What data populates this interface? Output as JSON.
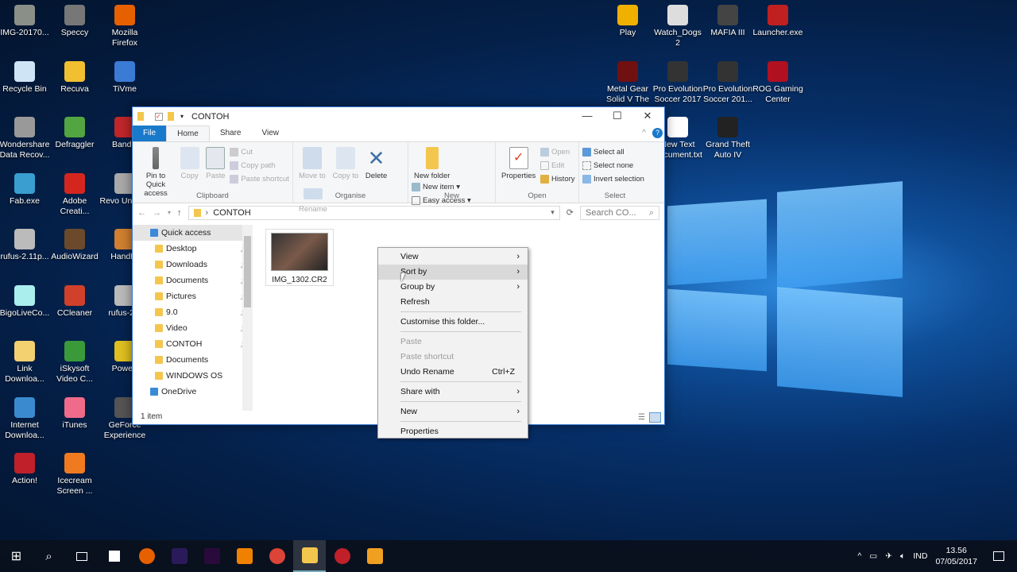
{
  "desktop": {
    "left_icons": [
      {
        "label": "IMG-20170...",
        "color": "#8a8f88"
      },
      {
        "label": "Speccy",
        "color": "#777"
      },
      {
        "label": "Mozilla Firefox",
        "color": "#e66000"
      },
      {
        "label": "Recycle Bin",
        "color": "#cfe4f5"
      },
      {
        "label": "Recuva",
        "color": "#f0c030"
      },
      {
        "label": "TiVme",
        "color": "#3a7bd5"
      },
      {
        "label": "Wondershare Data Recov...",
        "color": "#999"
      },
      {
        "label": "Defraggler",
        "color": "#52a540"
      },
      {
        "label": "Bandic",
        "color": "#c0262a"
      },
      {
        "label": "Fab.exe",
        "color": "#3a9ed0"
      },
      {
        "label": "Adobe Creati...",
        "color": "#d4261f"
      },
      {
        "label": "Revo Uninsta",
        "color": "#aaa"
      },
      {
        "label": "rufus-2.11p...",
        "color": "#bbb"
      },
      {
        "label": "AudioWizard",
        "color": "#6a4a2a"
      },
      {
        "label": "HandBr",
        "color": "#d08030"
      },
      {
        "label": "BigoLiveCo...",
        "color": "#aee"
      },
      {
        "label": "CCleaner",
        "color": "#d0402a"
      },
      {
        "label": "rufus-2.6",
        "color": "#bbb"
      },
      {
        "label": "Link Downloa...",
        "color": "#f3d070"
      },
      {
        "label": "iSkysoft Video C...",
        "color": "#3a9a3a"
      },
      {
        "label": "PowerI",
        "color": "#e0c020"
      },
      {
        "label": "Internet Downloa...",
        "color": "#3a8ad0"
      },
      {
        "label": "iTunes",
        "color": "#f06a8a"
      },
      {
        "label": "GeForce Experience",
        "color": "#555"
      },
      {
        "label": "Action!",
        "color": "#c0202a"
      },
      {
        "label": "Icecream Screen ...",
        "color": "#f07a20"
      }
    ],
    "right_icons": [
      {
        "label": "Play",
        "color": "#f0b000"
      },
      {
        "label": "Watch_Dogs 2",
        "color": "#ddd"
      },
      {
        "label": "MAFIA III",
        "color": "#444"
      },
      {
        "label": "Launcher.exe",
        "color": "#c02020"
      },
      {
        "label": "Metal Gear Solid V The ...",
        "color": "#701010"
      },
      {
        "label": "Pro Evolution Soccer 2017",
        "color": "#333"
      },
      {
        "label": "Pro Evolution Soccer 201...",
        "color": "#333"
      },
      {
        "label": "ROG Gaming Center",
        "color": "#b01020"
      },
      {
        "label": "New Text Document.txt",
        "color": "#fff"
      },
      {
        "label": "Grand Theft Auto IV",
        "color": "#222"
      }
    ]
  },
  "explorer": {
    "title": "CONTOH",
    "tabs": [
      "File",
      "Home",
      "Share",
      "View"
    ],
    "ribbon": {
      "clipboard": {
        "pin": "Pin to Quick access",
        "copy": "Copy",
        "paste": "Paste",
        "cut": "Cut",
        "copy_path": "Copy path",
        "paste_shortcut": "Paste shortcut",
        "label": "Clipboard"
      },
      "organise": {
        "move": "Move to",
        "copy": "Copy to",
        "delete": "Delete",
        "rename": "Rename",
        "label": "Organise"
      },
      "new": {
        "folder": "New folder",
        "item": "New item",
        "easy": "Easy access",
        "label": "New"
      },
      "open": {
        "properties": "Properties",
        "open": "Open",
        "edit": "Edit",
        "history": "History",
        "label": "Open"
      },
      "select": {
        "all": "Select all",
        "none": "Select none",
        "invert": "Invert selection",
        "label": "Select"
      }
    },
    "address": "CONTOH",
    "search_placeholder": "Search CO...",
    "nav": [
      {
        "label": "Quick access",
        "pin": false
      },
      {
        "label": "Desktop",
        "pin": true
      },
      {
        "label": "Downloads",
        "pin": true
      },
      {
        "label": "Documents",
        "pin": true
      },
      {
        "label": "Pictures",
        "pin": true
      },
      {
        "label": "9.0",
        "pin": true
      },
      {
        "label": "Video",
        "pin": true
      },
      {
        "label": "CONTOH",
        "pin": true
      },
      {
        "label": "Documents",
        "pin": false
      },
      {
        "label": "WINDOWS OS",
        "pin": false
      },
      {
        "label": "OneDrive",
        "pin": false
      }
    ],
    "file": {
      "name": "IMG_1302.CR2"
    },
    "status": "1 item"
  },
  "context_menu": [
    {
      "label": "View",
      "arrow": true
    },
    {
      "label": "Sort by",
      "arrow": true,
      "highlight": true
    },
    {
      "label": "Group by",
      "arrow": true
    },
    {
      "label": "Refresh"
    },
    {
      "sep": true
    },
    {
      "label": "Customise this folder..."
    },
    {
      "sep": true
    },
    {
      "label": "Paste",
      "disabled": true
    },
    {
      "label": "Paste shortcut",
      "disabled": true
    },
    {
      "label": "Undo Rename",
      "shortcut": "Ctrl+Z"
    },
    {
      "sep": true
    },
    {
      "label": "Share with",
      "arrow": true
    },
    {
      "sep": true
    },
    {
      "label": "New",
      "arrow": true
    },
    {
      "sep": true
    },
    {
      "label": "Properties"
    }
  ],
  "taskbar": {
    "apps": [
      {
        "name": "firefox",
        "color": "#e66000"
      },
      {
        "name": "after-effects",
        "color": "#2a1a5a"
      },
      {
        "name": "premiere",
        "color": "#2a0a3a"
      },
      {
        "name": "vlc",
        "color": "#f08000"
      },
      {
        "name": "chrome",
        "color": "#db4437"
      },
      {
        "name": "file-explorer",
        "color": "#f3c64e"
      },
      {
        "name": "record",
        "color": "#c0202a"
      },
      {
        "name": "app",
        "color": "#f0a020"
      }
    ],
    "lang": "IND",
    "time": "13.56",
    "date": "07/05/2017"
  }
}
